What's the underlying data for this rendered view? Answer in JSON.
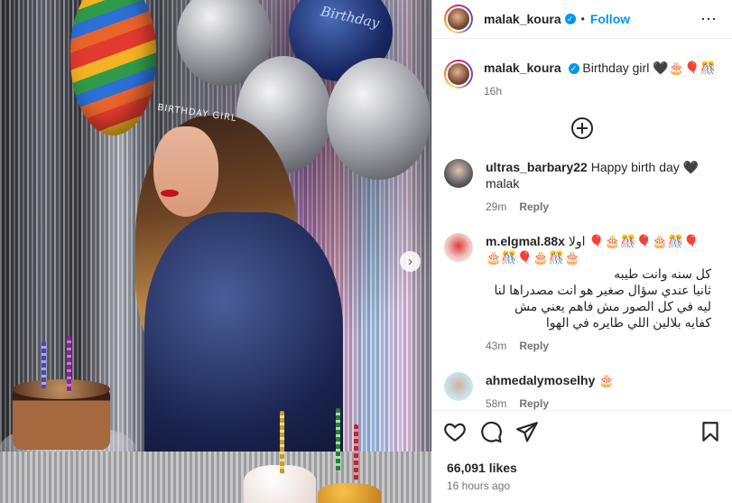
{
  "post": {
    "username": "malak_koura",
    "follow_label": "Follow",
    "caption": "Birthday girl 🖤🎂🎈🎊",
    "caption_time": "16h",
    "likes": "66,091 likes",
    "posted_ago": "16 hours ago",
    "photo_overlay": {
      "balloon_text": "Birthday",
      "tiara_text": "BIRTHDAY GIRL"
    }
  },
  "comments": [
    {
      "username": "ultras_barbary22",
      "text": "Happy birth day 🖤 malak",
      "time": "29m",
      "reply_label": "Reply"
    },
    {
      "username": "m.elgmal.88x",
      "text_line1": "اولا 🎈🎂🎊🎈🎂🎊🎈🎂🎊🎈🎂🎊🎂",
      "text_line2": "كل سنه وانت طيبه",
      "text_line3": "ثانيا عندي سؤال صغير هو انت مصدراها لنا ليه في كل الصور مش فاهم يعني مش كفايه بلالين اللي طايره في الهوا",
      "time": "43m",
      "reply_label": "Reply"
    },
    {
      "username": "ahmedalymoselhy",
      "text": "🎂",
      "time": "58m",
      "reply_label": "Reply"
    }
  ],
  "icons": {
    "like": "heart-icon",
    "comment": "comment-icon",
    "share": "paper-plane-icon",
    "save": "bookmark-icon",
    "load_more": "plus-circle-icon",
    "next": "chevron-right-icon"
  }
}
